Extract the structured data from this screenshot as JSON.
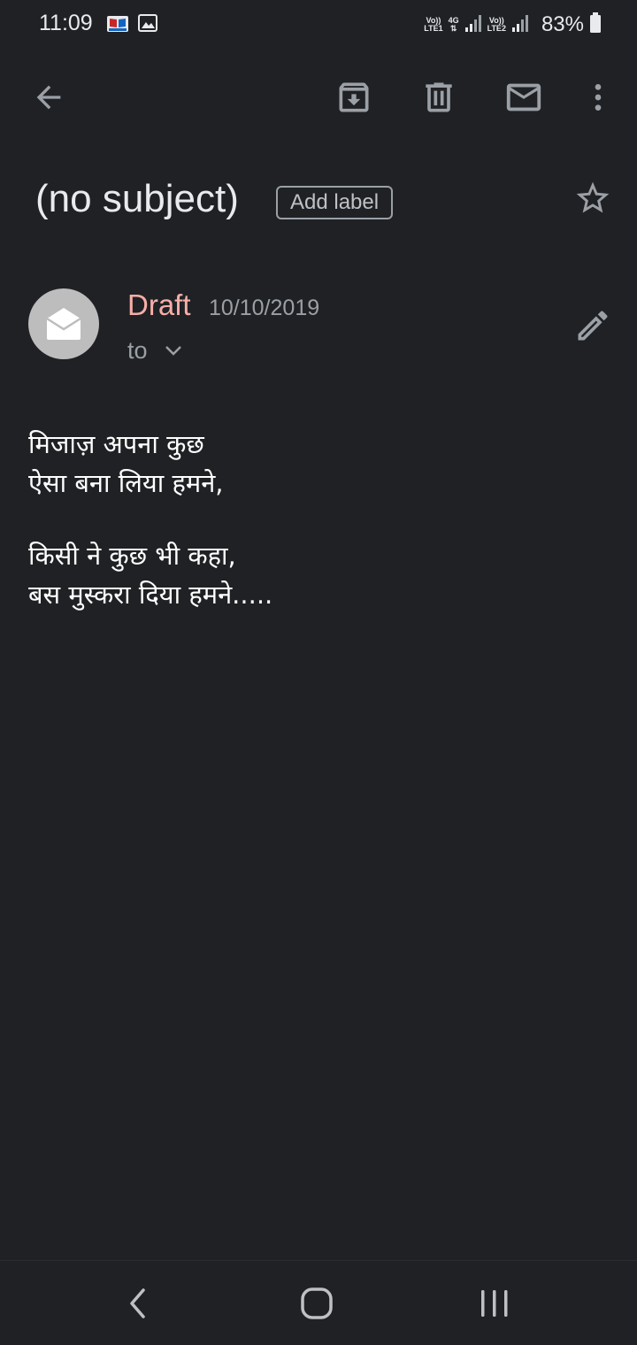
{
  "status_bar": {
    "time": "11:09",
    "sim1_top": "Vo))",
    "sim1_bottom": "LTE1",
    "network_type": "4G",
    "sim2_top": "Vo))",
    "sim2_bottom": "LTE2",
    "battery": "83%"
  },
  "toolbar": {
    "icons": [
      "back-arrow-icon",
      "archive-icon",
      "delete-icon",
      "mail-icon",
      "more-vert-icon"
    ]
  },
  "email": {
    "subject": "(no subject)",
    "add_label": "Add label",
    "sender": "Draft",
    "date": "10/10/2019",
    "to_label": "to",
    "body_lines": [
      "मिजाज़ अपना कुछ",
      "ऐसा बना लिया हमने,",
      "किसी ने कुछ भी कहा,",
      "बस मुस्करा दिया हमने....."
    ]
  },
  "colors": {
    "background": "#202124",
    "draft_accent": "#f6aea9",
    "secondary_text": "#9aa0a6"
  }
}
